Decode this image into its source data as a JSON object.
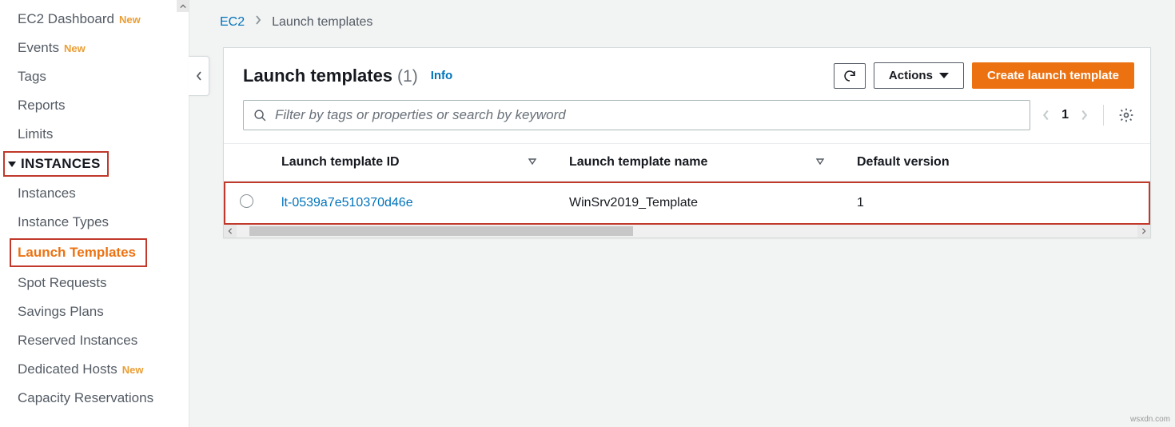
{
  "sidebar": {
    "items": [
      {
        "label": "EC2 Dashboard",
        "badge": "New"
      },
      {
        "label": "Events",
        "badge": "New"
      },
      {
        "label": "Tags"
      },
      {
        "label": "Reports"
      },
      {
        "label": "Limits"
      }
    ],
    "group_header": "INSTANCES",
    "group_items": [
      {
        "label": "Instances"
      },
      {
        "label": "Instance Types"
      },
      {
        "label": "Launch Templates",
        "active": true
      },
      {
        "label": "Spot Requests"
      },
      {
        "label": "Savings Plans"
      },
      {
        "label": "Reserved Instances"
      },
      {
        "label": "Dedicated Hosts",
        "badge": "New"
      },
      {
        "label": "Capacity Reservations"
      }
    ]
  },
  "breadcrumb": {
    "root": "EC2",
    "current": "Launch templates"
  },
  "header": {
    "title": "Launch templates",
    "count": "(1)",
    "info": "Info",
    "actions_label": "Actions",
    "create_label": "Create launch template"
  },
  "search": {
    "placeholder": "Filter by tags or properties or search by keyword"
  },
  "pagination": {
    "page": "1"
  },
  "table": {
    "columns": {
      "id": "Launch template ID",
      "name": "Launch template name",
      "default_version": "Default version"
    },
    "rows": [
      {
        "id": "lt-0539a7e510370d46e",
        "name": "WinSrv2019_Template",
        "default_version": "1"
      }
    ]
  },
  "watermark": "wsxdn.com"
}
